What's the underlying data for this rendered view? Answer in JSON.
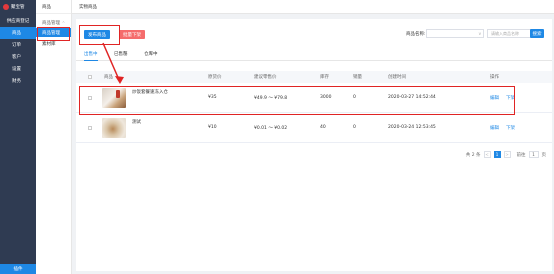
{
  "app": {
    "logo_text": "聚宝管",
    "shop_name": "供应商登记"
  },
  "sidebar": {
    "items": [
      {
        "label": "商品"
      },
      {
        "label": "订单"
      },
      {
        "label": "客户"
      },
      {
        "label": "设置"
      },
      {
        "label": "财务"
      }
    ],
    "bottom_label": "插件"
  },
  "subnav": {
    "title": "商品",
    "group_label": "商品管理",
    "items": [
      {
        "label": "商品管理"
      },
      {
        "label": "素材库"
      }
    ]
  },
  "topbar": {
    "tab": "实物商品"
  },
  "toolbar": {
    "publish_label": "发布商品",
    "batch_delist_label": "批量下架",
    "filter_label": "商品名称:",
    "search_placeholder": "请输入商品名称",
    "search_label": "搜索"
  },
  "tabs": [
    {
      "label": "出售中"
    },
    {
      "label": "已售罄"
    },
    {
      "label": "仓库中"
    }
  ],
  "table": {
    "headers": [
      "商品",
      "原货价",
      "建议零售价",
      "库存",
      "销量",
      "创建时间",
      "操作"
    ],
    "rows": [
      {
        "name": "炒饭套餐速冻入仓",
        "price": "¥35",
        "retail": "¥49.9 ～ ¥79.8",
        "stock": "3000",
        "sales": "0",
        "created": "2020-03-27 14:52:44",
        "edit": "编辑",
        "delist": "下架"
      },
      {
        "name": "测试",
        "price": "¥10",
        "retail": "¥0.01 ～ ¥0.02",
        "stock": "40",
        "sales": "0",
        "created": "2020-03-24 12:53:45",
        "edit": "编辑",
        "delist": "下架"
      }
    ]
  },
  "pager": {
    "total": "共 2 条",
    "prev": "<",
    "page": "1",
    "next": ">",
    "goto": "前往",
    "input": "1",
    "suffix": "页"
  },
  "colors": {
    "primary": "#1e88e5",
    "danger": "#f56c6c",
    "sidebar": "#2f3b52",
    "highlight": "#e02424"
  }
}
